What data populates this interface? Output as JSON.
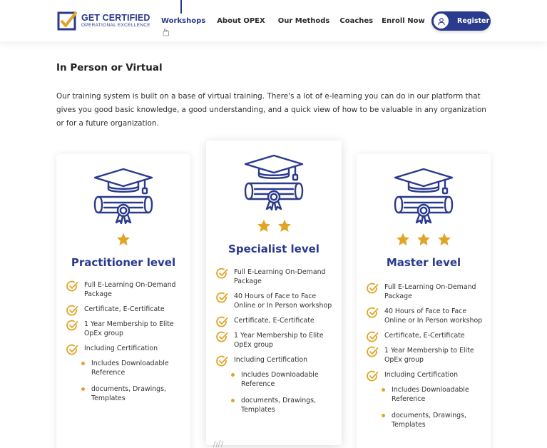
{
  "brand": {
    "name": "GET CERTIFIED",
    "tagline": "OPERATIONAL EXCELLENCE",
    "primary_color": "#2a3a8c",
    "accent_color": "#e0a526"
  },
  "nav": {
    "items": [
      {
        "label": "Workshops",
        "active": true
      },
      {
        "label": "About OPEX",
        "active": false
      },
      {
        "label": "Our Methods",
        "active": false
      },
      {
        "label": "Coaches",
        "active": false
      },
      {
        "label": "Enroll Now",
        "active": false
      }
    ],
    "register_label": "Register",
    "register_icon": "user-icon"
  },
  "section": {
    "title": "In Person or Virtual",
    "intro": "Our training system is built on a base of virtual training. There's a lot of e-learning you can do in our platform that gives you good basic knowledge, a good understanding, and a quick view of how to be valuable in any organization or for a future organization."
  },
  "cards": [
    {
      "title": "Practitioner level",
      "stars": 1,
      "icon": "graduation-diploma-icon",
      "features": [
        "Full E-Learning On-Demand Package",
        "Certificate, E-Certificate",
        "1 Year Membership to Elite OpEx group",
        "Including Certification"
      ],
      "subfeatures": [
        "Includes Downloadable Reference",
        "documents, Drawings, Templates"
      ]
    },
    {
      "title": "Specialist level",
      "stars": 2,
      "icon": "graduation-diploma-icon",
      "features": [
        "Full E-Learning On-Demand Package",
        "40 Hours of Face to Face Online or In Person workshop",
        "Certificate, E-Certificate",
        "1 Year Membership to Elite OpEx group",
        "Including Certification"
      ],
      "subfeatures": [
        "Includes Downloadable Reference",
        "documents, Drawings, Templates"
      ]
    },
    {
      "title": "Master level",
      "stars": 3,
      "icon": "graduation-diploma-icon",
      "features": [
        "Full E-Learning On-Demand Package",
        "40 Hours of Face to Face Online or In Person workshop",
        "Certificate, E-Certificate",
        "1 Year Membership to Elite OpEx group",
        "Including Certification"
      ],
      "subfeatures": [
        "Includes Downloadable Reference",
        "documents, Drawings, Templates"
      ]
    }
  ]
}
